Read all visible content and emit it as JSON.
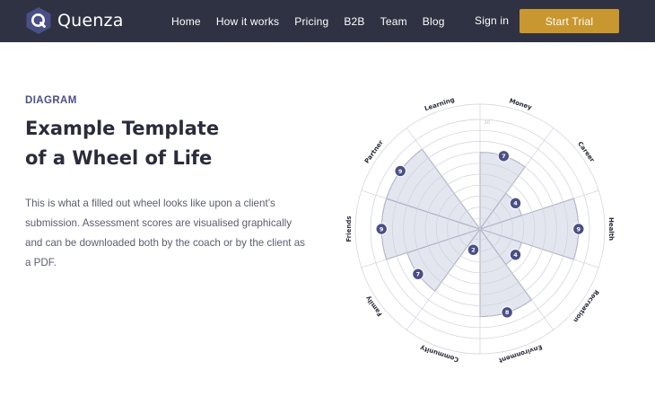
{
  "brand": {
    "name": "Quenza",
    "logo_icon": "q-hexagon-logo",
    "colors": {
      "nav_bg": "#2f3242",
      "accent": "#c9972f",
      "wheel_fill": "#e4e6ef",
      "wheel_line": "#4a4f86"
    }
  },
  "nav": {
    "links": [
      "Home",
      "How it works",
      "Pricing",
      "B2B",
      "Team",
      "Blog"
    ],
    "sign_in": "Sign in",
    "cta": "Start Trial"
  },
  "content": {
    "eyebrow": "DIAGRAM",
    "title_line1": "Example Template",
    "title_line2": "of a Wheel of Life",
    "description": "This is what a filled out wheel looks like upon a client’s submission. Assessment scores are visualised graphically and can be downloaded both by the coach or by the client as a PDF."
  },
  "chart_data": {
    "type": "radial-bar",
    "scale_max": 10,
    "scale_label": "10",
    "categories": [
      "Money",
      "Career",
      "Health",
      "Recreation",
      "Environment",
      "Community",
      "Family",
      "Friends",
      "Partner",
      "Learning"
    ],
    "values": [
      7,
      4,
      9,
      4,
      8,
      2,
      7,
      9,
      9,
      0
    ]
  }
}
